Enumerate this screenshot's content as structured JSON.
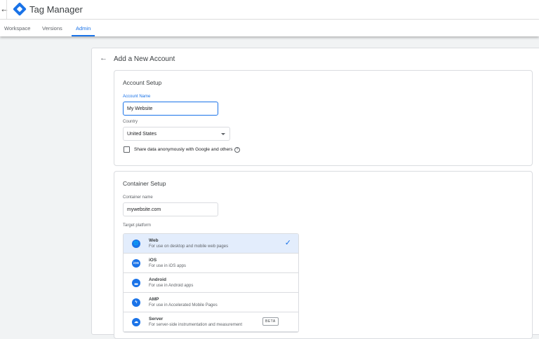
{
  "header": {
    "title": "Tag Manager"
  },
  "tabs": [
    {
      "label": "Workspace"
    },
    {
      "label": "Versions"
    },
    {
      "label": "Admin"
    }
  ],
  "page": {
    "title": "Add a New Account"
  },
  "account": {
    "section_title": "Account Setup",
    "name_label": "Account Name",
    "name_value": "My Website",
    "country_label": "Country",
    "country_value": "United States",
    "share_label": "Share data anonymously with Google and others"
  },
  "container": {
    "section_title": "Container Setup",
    "name_label": "Container name",
    "name_value": "mywebsite.com",
    "platform_label": "Target platform",
    "platforms": [
      {
        "name": "Web",
        "desc": "For use on desktop and mobile web pages",
        "icon": "🌐"
      },
      {
        "name": "iOS",
        "desc": "For use in iOS apps",
        "icon": "iOS"
      },
      {
        "name": "Android",
        "desc": "For use in Android apps",
        "icon": "▂"
      },
      {
        "name": "AMP",
        "desc": "For use in Accelerated Mobile Pages",
        "icon": "ϟ"
      },
      {
        "name": "Server",
        "desc": "For server-side instrumentation and measurement",
        "icon": "☁",
        "badge": "BETA"
      }
    ]
  }
}
